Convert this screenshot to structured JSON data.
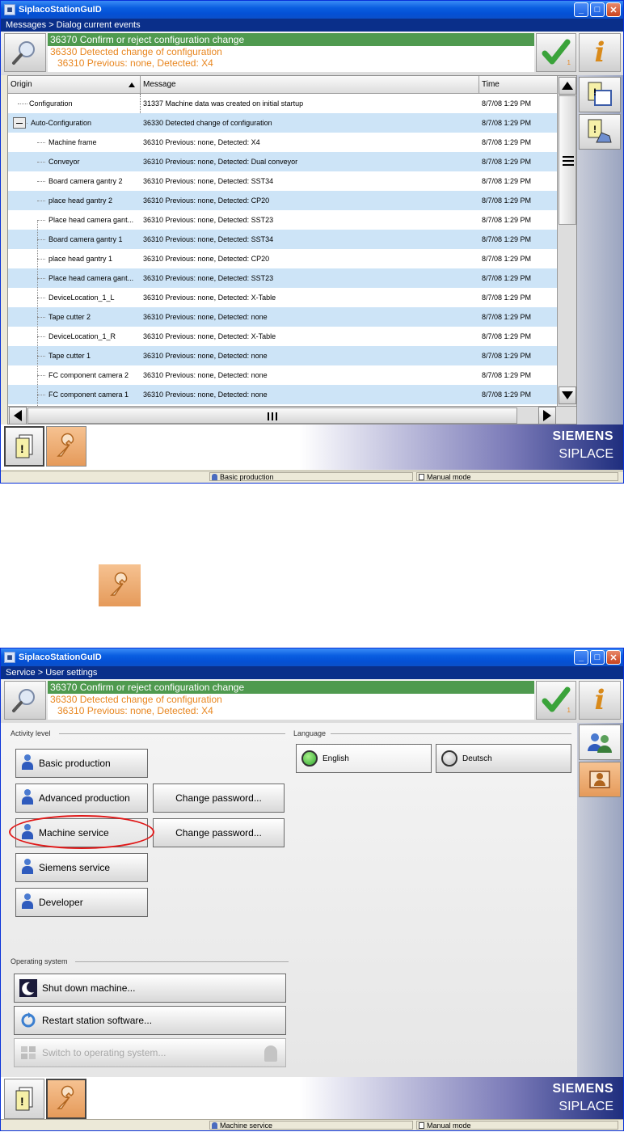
{
  "top_window": {
    "title": "SiplacoStationGuID",
    "breadcrumb": "Messages > Dialog current events",
    "message": {
      "main": "36370 Confirm or reject configuration change",
      "sub1": "36330 Detected change of configuration",
      "sub2": "36310 Previous: none, Detected: X4"
    },
    "confirm_count": "1",
    "columns": [
      "Origin",
      "Message",
      "Time"
    ],
    "rows": [
      {
        "origin": "Configuration",
        "message": "31337 Machine data was created on initial startup",
        "time": "8/7/08 1:29 PM"
      },
      {
        "origin": "Auto-Configuration",
        "message": "36330 Detected change of configuration",
        "time": "8/7/08 1:29 PM"
      },
      {
        "origin": "Machine frame",
        "message": "36310 Previous: none, Detected: X4",
        "time": "8/7/08 1:29 PM"
      },
      {
        "origin": "Conveyor",
        "message": "36310 Previous: none, Detected: Dual conveyor",
        "time": "8/7/08 1:29 PM"
      },
      {
        "origin": "Board camera gantry 2",
        "message": "36310 Previous: none, Detected: SST34",
        "time": "8/7/08 1:29 PM"
      },
      {
        "origin": "place head gantry 2",
        "message": "36310 Previous: none, Detected: CP20",
        "time": "8/7/08 1:29 PM"
      },
      {
        "origin": "Place head camera gant...",
        "message": "36310 Previous: none, Detected: SST23",
        "time": "8/7/08 1:29 PM"
      },
      {
        "origin": "Board camera gantry 1",
        "message": "36310 Previous: none, Detected: SST34",
        "time": "8/7/08 1:29 PM"
      },
      {
        "origin": "place head gantry 1",
        "message": "36310 Previous: none, Detected: CP20",
        "time": "8/7/08 1:29 PM"
      },
      {
        "origin": "Place head camera gant...",
        "message": "36310 Previous: none, Detected: SST23",
        "time": "8/7/08 1:29 PM"
      },
      {
        "origin": "DeviceLocation_1_L",
        "message": "36310 Previous: none, Detected: X-Table",
        "time": "8/7/08 1:29 PM"
      },
      {
        "origin": "Tape cutter 2",
        "message": "36310 Previous: none, Detected: none",
        "time": "8/7/08 1:29 PM"
      },
      {
        "origin": "DeviceLocation_1_R",
        "message": "36310 Previous: none, Detected: X-Table",
        "time": "8/7/08 1:29 PM"
      },
      {
        "origin": "Tape cutter 1",
        "message": "36310 Previous: none, Detected: none",
        "time": "8/7/08 1:29 PM"
      },
      {
        "origin": "FC component camera 2",
        "message": "36310 Previous: none, Detected: none",
        "time": "8/7/08 1:29 PM"
      },
      {
        "origin": "FC component camera 1",
        "message": "36310 Previous: none, Detected: none",
        "time": "8/7/08 1:29 PM"
      }
    ],
    "brand": "SIEMENS",
    "product": "SIPLACE",
    "status_user": "Basic production",
    "status_mode": "Manual mode"
  },
  "bottom_window": {
    "title": "SiplacoStationGuID",
    "breadcrumb": "Service > User settings",
    "message": {
      "main": "36370 Confirm or reject configuration change",
      "sub1": "36330 Detected change of configuration",
      "sub2": "36310 Previous: none, Detected: X4"
    },
    "confirm_count": "1",
    "activity_label": "Activity level",
    "language_label": "Language",
    "activity_buttons": [
      "Basic production",
      "Advanced production",
      "Machine service",
      "Siemens service",
      "Developer"
    ],
    "change_password": "Change password...",
    "languages": [
      "English",
      "Deutsch"
    ],
    "os_label": "Operating system",
    "os_buttons": [
      "Shut down machine...",
      "Restart station software...",
      "Switch to operating system..."
    ],
    "brand": "SIEMENS",
    "product": "SIPLACE",
    "status_user": "Machine service",
    "status_mode": "Manual mode"
  },
  "colors": {
    "title_blue": "#0a5ee0",
    "breadcrumb_blue": "#0a2f8a",
    "message_green": "#4f9a4f",
    "message_orange": "#e8861f",
    "row_alt": "#cde4f7",
    "highlight_red": "#e01818",
    "active_orange": "#e59a5a"
  },
  "icons": [
    "magnifier-icon",
    "checkmark-icon",
    "info-icon",
    "messages-icon",
    "settings-wrench-icon",
    "users-icon",
    "station-icon",
    "moon-icon",
    "restart-icon",
    "windows-icon"
  ]
}
